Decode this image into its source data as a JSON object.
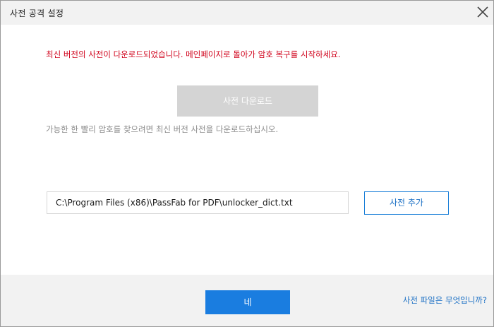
{
  "window": {
    "title": "사전 공격 설정",
    "close_icon": "close-icon"
  },
  "main": {
    "notice_text": "최신 버전의 사전이 다운로드되었습니다. 메인페이지로 돌아가 암호 복구를 시작하세요.",
    "download_button_label": "사전 다운로드",
    "hint_text": "가능한 한 빨리 암호를 찾으려면 최신 버전 사전을 다운로드하십시오.",
    "dictionary_path": "C:\\Program Files (x86)\\PassFab for PDF\\unlocker_dict.txt",
    "add_dictionary_label": "사전 추가"
  },
  "footer": {
    "ok_label": "네",
    "help_link": "사전 파일은 무엇입니까?"
  },
  "colors": {
    "notice": "#d0021b",
    "accent": "#1a7de0",
    "disabled_button": "#d4d4d4"
  }
}
